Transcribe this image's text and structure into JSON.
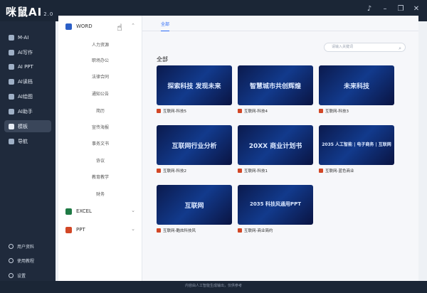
{
  "app": {
    "brand": "咪鼠AI",
    "version": "2.0"
  },
  "sidebar": {
    "items": [
      {
        "label": "M-AI"
      },
      {
        "label": "AI写作"
      },
      {
        "label": "AI PPT"
      },
      {
        "label": "AI读档"
      },
      {
        "label": "AI绘图"
      },
      {
        "label": "AI助手"
      },
      {
        "label": "模板"
      },
      {
        "label": "导航"
      }
    ],
    "bottom": [
      {
        "label": "用户资料"
      },
      {
        "label": "使用教程"
      },
      {
        "label": "设置"
      }
    ]
  },
  "categories": {
    "word": {
      "label": "WORD",
      "subs": [
        "人力资源",
        "职场办公",
        "法律合同",
        "通知公告",
        "简历",
        "宣传海报",
        "事务文书",
        "协议",
        "教育教学",
        "财务"
      ]
    },
    "excel": {
      "label": "EXCEL"
    },
    "ppt": {
      "label": "PPT"
    }
  },
  "tabs": {
    "all": "全部"
  },
  "search": {
    "placeholder": "请输入关键词"
  },
  "section": {
    "title": "全部"
  },
  "cards": [
    {
      "thumb": "探索科技 发现未来",
      "caption": "互联网-科技5"
    },
    {
      "thumb": "智慧城市共创辉煌",
      "caption": "互联网-科技4"
    },
    {
      "thumb": "未来科技",
      "caption": "互联网-科技3"
    },
    {
      "thumb": "互联网行业分析",
      "caption": "互联网-科技2"
    },
    {
      "thumb": "20XX 商业计划书",
      "caption": "互联网-科技1"
    },
    {
      "thumb": "2035 人工智能 | 电子商务 | 互联网",
      "caption": "互联网-蓝色商业"
    },
    {
      "thumb": "互联网",
      "caption": "互联网-酷炫科技风"
    },
    {
      "thumb": "2035 科技风通用PPT",
      "caption": "互联网-商业简约"
    }
  ],
  "footer": {
    "note": "内容由人工智能生成输出，仅供参考"
  }
}
